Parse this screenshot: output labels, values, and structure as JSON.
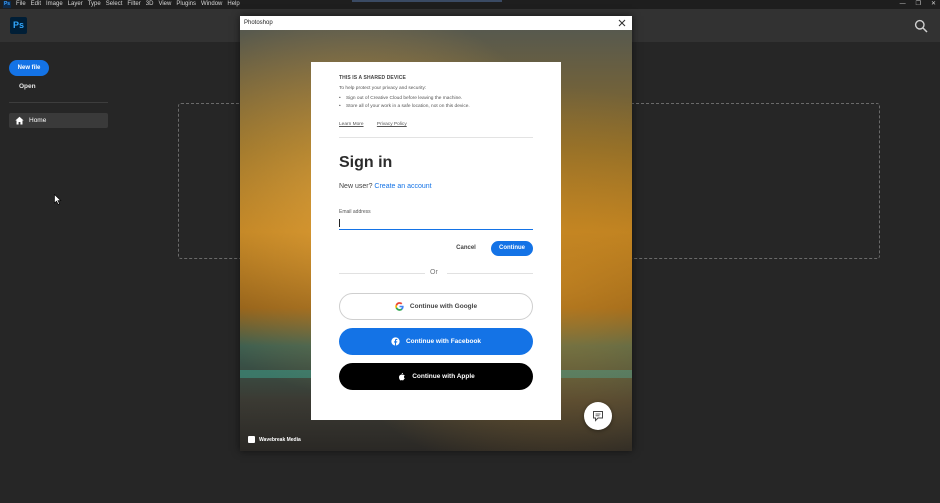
{
  "menubar": {
    "app_icon": "Ps",
    "items": [
      "File",
      "Edit",
      "Image",
      "Layer",
      "Type",
      "Select",
      "Filter",
      "3D",
      "View",
      "Plugins",
      "Window",
      "Help"
    ],
    "window_controls": [
      "minimize-icon",
      "restore-icon",
      "close-icon"
    ]
  },
  "home": {
    "logo": "Ps",
    "new_file_label": "New file",
    "open_label": "Open",
    "nav_home_label": "Home"
  },
  "dialog": {
    "title": "Photoshop",
    "photo_credit": "Wavebreak Media",
    "card": {
      "shared_title": "THIS IS A SHARED DEVICE",
      "shared_intro": "To help protect your privacy and security:",
      "shared_points": [
        "Sign out of Creative Cloud before leaving the machine.",
        "Store all of your work in a safe location, not on this device."
      ],
      "learn_more": "Learn More",
      "privacy_policy": "Privacy Policy",
      "heading": "Sign in",
      "new_user_prefix": "New user?",
      "create_account": "Create an account",
      "email_label": "Email address",
      "email_value": "",
      "cancel_label": "Cancel",
      "continue_label": "Continue",
      "or_label": "Or",
      "google_label": "Continue with Google",
      "facebook_label": "Continue with Facebook",
      "apple_label": "Continue with Apple"
    }
  },
  "colors": {
    "accent": "#1473e6",
    "app_bg": "#262626",
    "header_bg": "#323232",
    "apple_btn": "#000000"
  }
}
